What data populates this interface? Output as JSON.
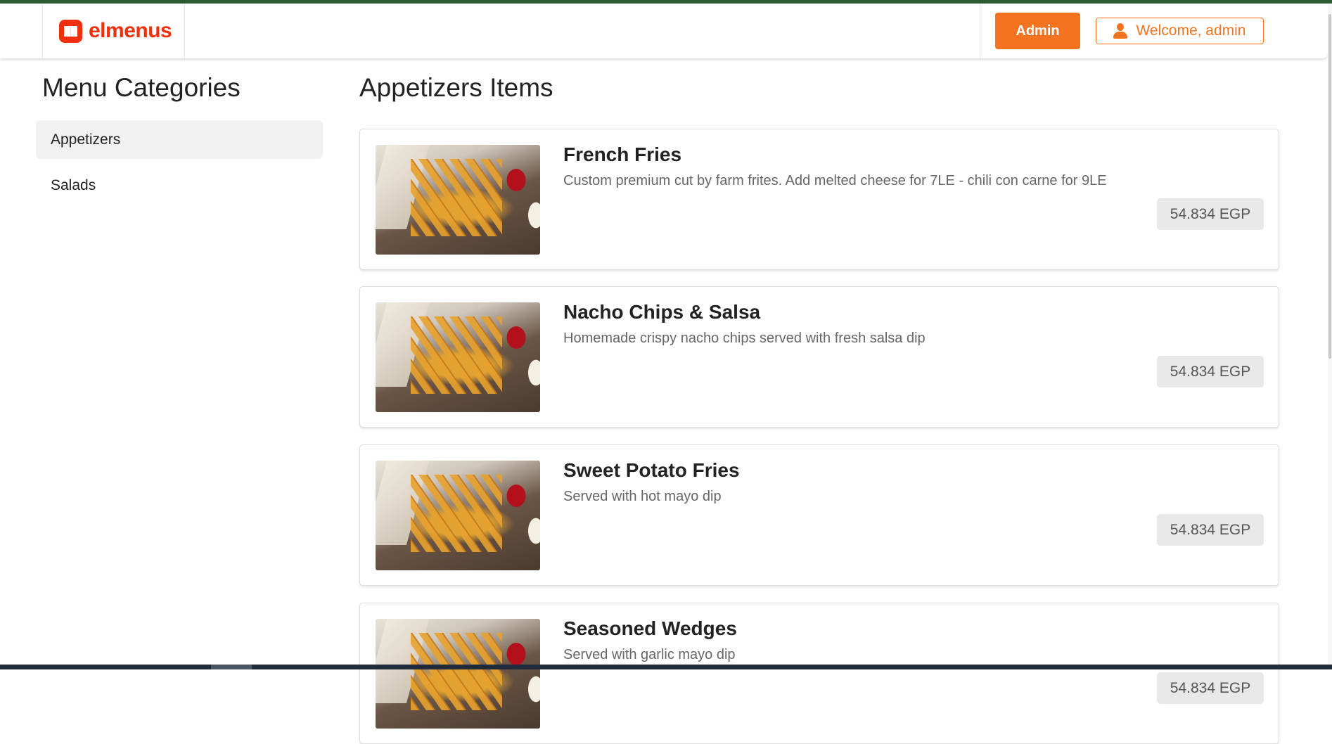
{
  "header": {
    "logo_text": "elmenus",
    "admin_label": "Admin",
    "welcome_label": "Welcome, admin"
  },
  "sidebar": {
    "title": "Menu Categories",
    "items": [
      {
        "label": "Appetizers",
        "active": true
      },
      {
        "label": "Salads",
        "active": false
      }
    ]
  },
  "main": {
    "title": "Appetizers Items",
    "items": [
      {
        "name": "French Fries",
        "description": "Custom premium cut by farm frites. Add melted cheese for 7LE - chili con carne for 9LE",
        "price": "54.834 EGP"
      },
      {
        "name": "Nacho Chips & Salsa",
        "description": "Homemade crispy nacho chips served with fresh salsa dip",
        "price": "54.834 EGP"
      },
      {
        "name": "Sweet Potato Fries",
        "description": "Served with hot mayo dip",
        "price": "54.834 EGP"
      },
      {
        "name": "Seasoned Wedges",
        "description": "Served with garlic mayo dip",
        "price": "54.834 EGP"
      }
    ]
  },
  "colors": {
    "brand": "#f0300c",
    "accent": "#f37321"
  }
}
